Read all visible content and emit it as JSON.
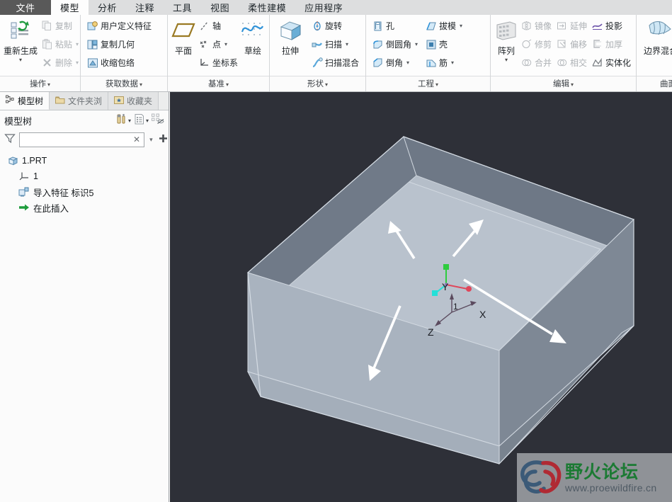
{
  "window": {
    "app": "Creo Parametric",
    "tabs": [
      {
        "label": "文件",
        "name": "tab-file",
        "active": false,
        "style": "file"
      },
      {
        "label": "模型",
        "name": "tab-model",
        "active": true
      },
      {
        "label": "分析",
        "name": "tab-analysis",
        "active": false
      },
      {
        "label": "注释",
        "name": "tab-annotate",
        "active": false
      },
      {
        "label": "工具",
        "name": "tab-tools",
        "active": false
      },
      {
        "label": "视图",
        "name": "tab-view",
        "active": false
      },
      {
        "label": "柔性建模",
        "name": "tab-flexible-modeling",
        "active": false
      },
      {
        "label": "应用程序",
        "name": "tab-applications",
        "active": false
      }
    ]
  },
  "ribbon": {
    "groups": [
      {
        "name": "group-operations",
        "label": "操作",
        "big": {
          "label": "重新生成",
          "icon": "regenerate-icon",
          "dropdown": true
        },
        "columns": [
          {
            "items": [
              {
                "label": "复制",
                "icon": "copy-icon",
                "disabled": true,
                "caret": false
              },
              {
                "label": "粘贴",
                "icon": "paste-icon",
                "disabled": true,
                "caret": true
              },
              {
                "label": "删除",
                "icon": "delete-x-icon",
                "disabled": true,
                "caret": true
              }
            ]
          }
        ]
      },
      {
        "name": "group-get-data",
        "label": "获取数据",
        "big": null,
        "columns": [
          {
            "items": [
              {
                "label": "用户定义特征",
                "icon": "udf-icon",
                "disabled": false,
                "caret": false
              },
              {
                "label": "复制几何",
                "icon": "copy-geometry-icon",
                "disabled": false,
                "caret": false
              },
              {
                "label": "收缩包络",
                "icon": "shrinkwrap-icon",
                "disabled": false,
                "caret": false
              }
            ]
          }
        ]
      },
      {
        "name": "group-datum",
        "label": "基准",
        "big": {
          "label": "平面",
          "icon": "datum-plane-icon",
          "dropdown": false
        },
        "columns": [
          {
            "items": [
              {
                "label": "轴",
                "icon": "datum-axis-icon",
                "disabled": false,
                "caret": false
              },
              {
                "label": "点",
                "icon": "datum-point-icon",
                "disabled": false,
                "caret": true
              },
              {
                "label": "坐标系",
                "icon": "coordinate-system-icon",
                "disabled": false,
                "caret": false
              }
            ]
          }
        ],
        "big2": {
          "label": "草绘",
          "icon": "sketch-icon",
          "dropdown": false
        }
      },
      {
        "name": "group-shapes",
        "label": "形状",
        "big": {
          "label": "拉伸",
          "icon": "extrude-icon",
          "dropdown": false
        },
        "columns": [
          {
            "items": [
              {
                "label": "旋转",
                "icon": "revolve-icon",
                "disabled": false,
                "caret": false
              },
              {
                "label": "扫描",
                "icon": "sweep-icon",
                "disabled": false,
                "caret": true
              },
              {
                "label": "扫描混合",
                "icon": "swept-blend-icon",
                "disabled": false,
                "caret": false
              }
            ]
          }
        ]
      },
      {
        "name": "group-engineering",
        "label": "工程",
        "big": null,
        "columns": [
          {
            "items": [
              {
                "label": "孔",
                "icon": "hole-icon",
                "disabled": false,
                "caret": false
              },
              {
                "label": "倒圆角",
                "icon": "round-icon",
                "disabled": false,
                "caret": true
              },
              {
                "label": "倒角",
                "icon": "chamfer-icon",
                "disabled": false,
                "caret": true
              }
            ]
          },
          {
            "items": [
              {
                "label": "拔模",
                "icon": "draft-icon",
                "disabled": false,
                "caret": true
              },
              {
                "label": "壳",
                "icon": "shell-icon",
                "disabled": false,
                "caret": false
              },
              {
                "label": "筋",
                "icon": "rib-icon",
                "disabled": false,
                "caret": true
              }
            ]
          }
        ]
      },
      {
        "name": "group-editing",
        "label": "编辑",
        "big": {
          "label": "阵列",
          "icon": "pattern-icon",
          "dropdown": true
        },
        "columns": [
          {
            "items": [
              {
                "label": "镜像",
                "icon": "mirror-icon",
                "disabled": true,
                "caret": false
              },
              {
                "label": "修剪",
                "icon": "trim-icon",
                "disabled": true,
                "caret": false
              },
              {
                "label": "合并",
                "icon": "merge-icon",
                "disabled": true,
                "caret": false
              }
            ]
          },
          {
            "items": [
              {
                "label": "延伸",
                "icon": "extend-icon",
                "disabled": true,
                "caret": false
              },
              {
                "label": "偏移",
                "icon": "offset-icon",
                "disabled": true,
                "caret": false
              },
              {
                "label": "相交",
                "icon": "intersect-icon",
                "disabled": true,
                "caret": false
              }
            ]
          },
          {
            "items": [
              {
                "label": "投影",
                "icon": "project-icon",
                "disabled": false,
                "caret": false
              },
              {
                "label": "加厚",
                "icon": "thicken-icon",
                "disabled": true,
                "caret": false
              },
              {
                "label": "实体化",
                "icon": "solidify-icon",
                "disabled": false,
                "caret": false
              }
            ]
          }
        ]
      },
      {
        "name": "group-surfaces",
        "label": "曲面",
        "big": {
          "label": "边界混合",
          "icon": "boundary-blend-icon",
          "dropdown": false
        },
        "columns": [
          {
            "items": [
              {
                "label": "",
                "icon": "surface-fill-icon",
                "disabled": false,
                "caret": false
              },
              {
                "label": "",
                "icon": "surface-style-icon",
                "disabled": false,
                "caret": false
              },
              {
                "label": "",
                "icon": "surface-free-icon",
                "disabled": false,
                "caret": false
              }
            ]
          }
        ]
      }
    ]
  },
  "left_panel": {
    "tabs": [
      {
        "label": "模型树",
        "name": "panel-tab-model-tree",
        "icon": "model-tree-icon",
        "active": true
      },
      {
        "label": "文件夹浏",
        "name": "panel-tab-folder-browser",
        "icon": "folder-icon",
        "active": false
      },
      {
        "label": "收藏夹",
        "name": "panel-tab-favorites",
        "icon": "favorites-icon",
        "active": false
      }
    ],
    "toolbar": {
      "title": "模型树",
      "settings_icon": "tools-icon",
      "display_icon": "display-list-icon",
      "hide_icon": "tree-hide-icon"
    },
    "filter": {
      "icon": "filter-funnel-icon",
      "value": "",
      "placeholder": "",
      "clear_icon": "clear-x-icon",
      "dropdown_icon": "chevron-down-icon",
      "add_icon": "plus-icon"
    },
    "tree": [
      {
        "label": "1.PRT",
        "icon": "part-icon",
        "indent": 0,
        "name": "tree-item-part"
      },
      {
        "label": "1",
        "icon": "csys-icon",
        "indent": 1,
        "name": "tree-item-csys"
      },
      {
        "label": "导入特征 标识5",
        "icon": "import-feature-icon",
        "indent": 1,
        "name": "tree-item-import-feature"
      },
      {
        "label": "在此插入",
        "icon": "insert-here-arrow-icon",
        "indent": 1,
        "name": "tree-item-insert-here"
      }
    ]
  },
  "viewport": {
    "name": "graphics-window",
    "background_color": "#2e3038",
    "model": {
      "face_top_color": "#b3bcc8",
      "face_front_color": "#a7b1bd",
      "face_right_color": "#7c8693",
      "face_inner_color": "#727c8a",
      "edge_color": "#cfd6de"
    },
    "csys": {
      "label": "1",
      "axes": [
        {
          "label": "X",
          "name": "csys-axis-x"
        },
        {
          "label": "Y",
          "name": "csys-axis-y"
        },
        {
          "label": "Z",
          "name": "csys-axis-z"
        }
      ],
      "drag_handles": [
        {
          "color": "#2ecc3f",
          "name": "drag-handle-green"
        },
        {
          "color": "#e0465a",
          "name": "drag-handle-red"
        },
        {
          "color": "#24e0d8",
          "name": "drag-handle-cyan"
        }
      ]
    },
    "arrows": [
      {
        "name": "direction-arrow-upper-left"
      },
      {
        "name": "direction-arrow-upper-right"
      },
      {
        "name": "direction-arrow-lower-left"
      },
      {
        "name": "direction-arrow-lower-right"
      }
    ]
  },
  "watermark": {
    "name": "forum-watermark",
    "title": "野火论坛",
    "url": "www.proewildfire.cn",
    "title_color": "#1b7a33",
    "url_color": "#4f5a64"
  }
}
